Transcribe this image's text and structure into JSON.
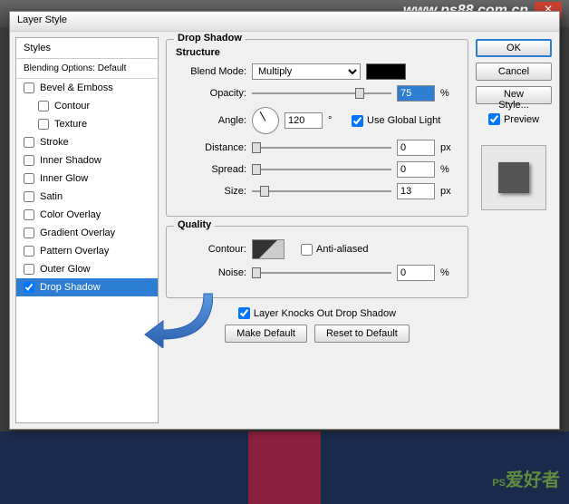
{
  "window": {
    "title": "Layer Style"
  },
  "watermark": {
    "url": "www.ps88.com.cn",
    "bottom_prefix": "PS",
    "bottom_zh": "爱好者"
  },
  "sidebar": {
    "header": "Styles",
    "blending": "Blending Options: Default",
    "items": [
      {
        "label": "Bevel & Emboss",
        "checked": false,
        "indent": false
      },
      {
        "label": "Contour",
        "checked": false,
        "indent": true
      },
      {
        "label": "Texture",
        "checked": false,
        "indent": true
      },
      {
        "label": "Stroke",
        "checked": false,
        "indent": false
      },
      {
        "label": "Inner Shadow",
        "checked": false,
        "indent": false
      },
      {
        "label": "Inner Glow",
        "checked": false,
        "indent": false
      },
      {
        "label": "Satin",
        "checked": false,
        "indent": false
      },
      {
        "label": "Color Overlay",
        "checked": false,
        "indent": false
      },
      {
        "label": "Gradient Overlay",
        "checked": false,
        "indent": false
      },
      {
        "label": "Pattern Overlay",
        "checked": false,
        "indent": false
      },
      {
        "label": "Outer Glow",
        "checked": false,
        "indent": false
      },
      {
        "label": "Drop Shadow",
        "checked": true,
        "indent": false,
        "selected": true
      }
    ]
  },
  "panel": {
    "title": "Drop Shadow",
    "structure": {
      "title": "Structure",
      "blend_mode_label": "Blend Mode:",
      "blend_mode_value": "Multiply",
      "opacity_label": "Opacity:",
      "opacity_value": "75",
      "opacity_unit": "%",
      "angle_label": "Angle:",
      "angle_value": "120",
      "angle_unit": "°",
      "global_light_label": "Use Global Light",
      "global_light_checked": true,
      "distance_label": "Distance:",
      "distance_value": "0",
      "distance_unit": "px",
      "spread_label": "Spread:",
      "spread_value": "0",
      "spread_unit": "%",
      "size_label": "Size:",
      "size_value": "13",
      "size_unit": "px"
    },
    "quality": {
      "title": "Quality",
      "contour_label": "Contour:",
      "antialiased_label": "Anti-aliased",
      "antialiased_checked": false,
      "noise_label": "Noise:",
      "noise_value": "0",
      "noise_unit": "%"
    },
    "knockout_label": "Layer Knocks Out Drop Shadow",
    "knockout_checked": true,
    "make_default": "Make Default",
    "reset_default": "Reset to Default"
  },
  "buttons": {
    "ok": "OK",
    "cancel": "Cancel",
    "new_style": "New Style...",
    "preview_label": "Preview",
    "preview_checked": true
  }
}
